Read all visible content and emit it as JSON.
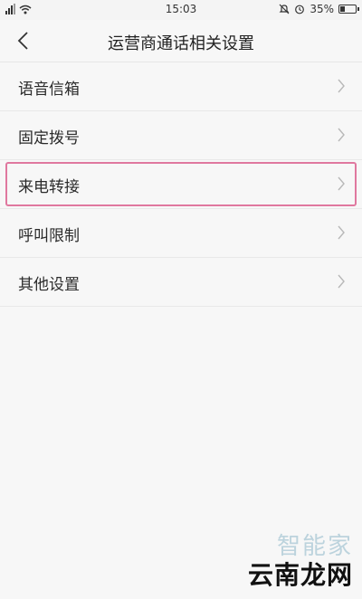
{
  "status_bar": {
    "time": "15:03",
    "battery": "35%",
    "battery_level": 0.35
  },
  "header": {
    "title": "运营商通话相关设置"
  },
  "icons": {
    "back": "chevron-left-icon",
    "item": "chevron-right-icon",
    "wifi": "wifi-icon",
    "signal": "signal-icon",
    "mute": "mute-bell-icon",
    "alarm": "alarm-icon",
    "battery": "battery-icon"
  },
  "menu_items": [
    {
      "label": "语音信箱"
    },
    {
      "label": "固定拨号"
    },
    {
      "label": "来电转接",
      "highlighted": true
    },
    {
      "label": "呼叫限制"
    },
    {
      "label": "其他设置"
    }
  ],
  "watermark": {
    "top": "智能家",
    "bottom": "云南龙网"
  },
  "colors": {
    "background": "#f7f7f7",
    "divider": "#e8e8e8",
    "highlight_border": "#e0789f",
    "text": "#2b2b2b",
    "chevron": "#b8b8b8"
  }
}
